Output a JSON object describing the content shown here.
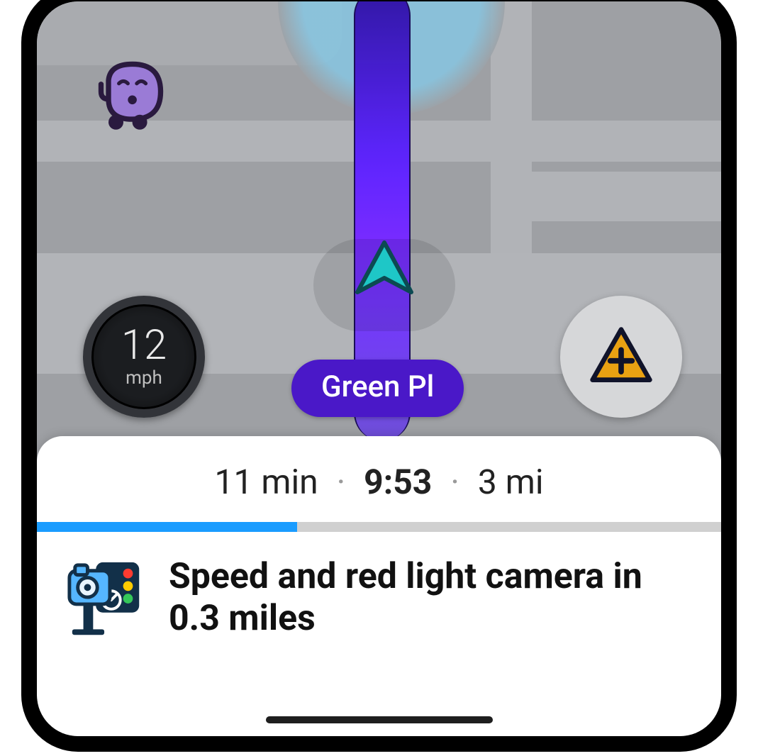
{
  "map": {
    "street_label": "Green Pl",
    "icons": {
      "avatar": "waze-avatar",
      "vehicle": "navigation-arrow",
      "report": "report-plus-triangle"
    }
  },
  "speedometer": {
    "value": "12",
    "unit": "mph"
  },
  "bottom_sheet": {
    "eta": {
      "duration": "11 min",
      "arrival_time": "9:53",
      "distance": "3 mi"
    },
    "progress_percent": 38,
    "alert": {
      "icon": "speed-camera",
      "text": "Speed and red light camera in 0.3 miles"
    }
  },
  "colors": {
    "route": "#5528d8",
    "chip": "#4a18c8",
    "progress": "#1a9cff",
    "report_triangle": "#e9a112"
  }
}
